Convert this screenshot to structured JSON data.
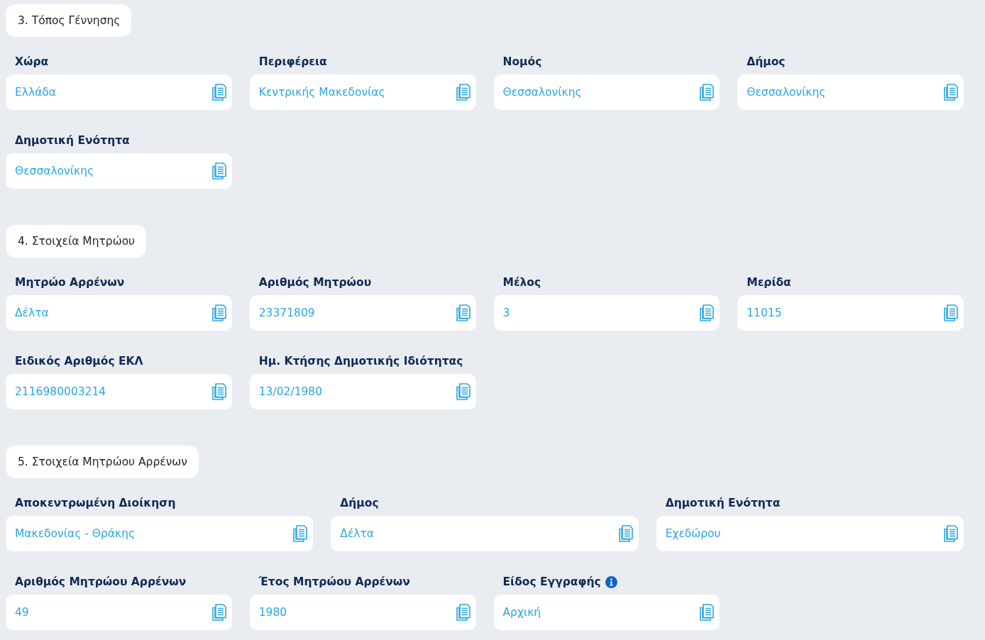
{
  "sections": [
    {
      "title": "3. Τόπος Γέννησης",
      "rows": [
        {
          "kind": "grid",
          "fields": [
            {
              "label": "Χώρα",
              "value": "Ελλάδα",
              "info": false
            },
            {
              "label": "Περιφέρεια",
              "value": "Κεντρικής Μακεδονίας",
              "info": false
            },
            {
              "label": "Νομός",
              "value": "Θεσσαλονίκης",
              "info": false
            },
            {
              "label": "Δήμος",
              "value": "Θεσσαλονίκης",
              "info": false
            }
          ]
        },
        {
          "kind": "grid",
          "fields": [
            {
              "label": "Δημοτική Ενότητα",
              "value": "Θεσσαλονίκης",
              "info": false
            }
          ]
        }
      ]
    },
    {
      "title": "4. Στοιχεία Μητρώου",
      "rows": [
        {
          "kind": "grid",
          "fields": [
            {
              "label": "Μητρώο Αρρένων",
              "value": "Δέλτα",
              "info": false
            },
            {
              "label": "Αριθμός Μητρώου",
              "value": "23371809",
              "info": false
            },
            {
              "label": "Μέλος",
              "value": "3",
              "info": false
            },
            {
              "label": "Μερίδα",
              "value": "11015",
              "info": false
            }
          ]
        },
        {
          "kind": "grid",
          "fields": [
            {
              "label": "Ειδικός Αριθμός ΕΚΛ",
              "value": "2116980003214",
              "info": false
            },
            {
              "label": "Ημ. Κτήσης Δημοτικής Ιδιότητας",
              "value": "13/02/1980",
              "info": false
            }
          ]
        }
      ]
    },
    {
      "title": "5. Στοιχεία Μητρώου Αρρένων",
      "rows": [
        {
          "kind": "wide",
          "fields": [
            {
              "label": "Αποκεντρωμένη Διοίκηση",
              "value": "Μακεδονίας - Θράκης",
              "info": false
            },
            {
              "label": "Δήμος",
              "value": "Δέλτα",
              "info": false
            },
            {
              "label": "Δημοτική Ενότητα",
              "value": "Εχεδώρου",
              "info": false
            }
          ]
        },
        {
          "kind": "grid",
          "fields": [
            {
              "label": "Αριθμός Μητρώου Αρρένων",
              "value": "49",
              "info": false
            },
            {
              "label": "Έτος Μητρώου Αρρένων",
              "value": "1980",
              "info": false
            },
            {
              "label": "Είδος Εγγραφής",
              "value": "Αρχική",
              "info": true
            }
          ]
        }
      ]
    }
  ]
}
